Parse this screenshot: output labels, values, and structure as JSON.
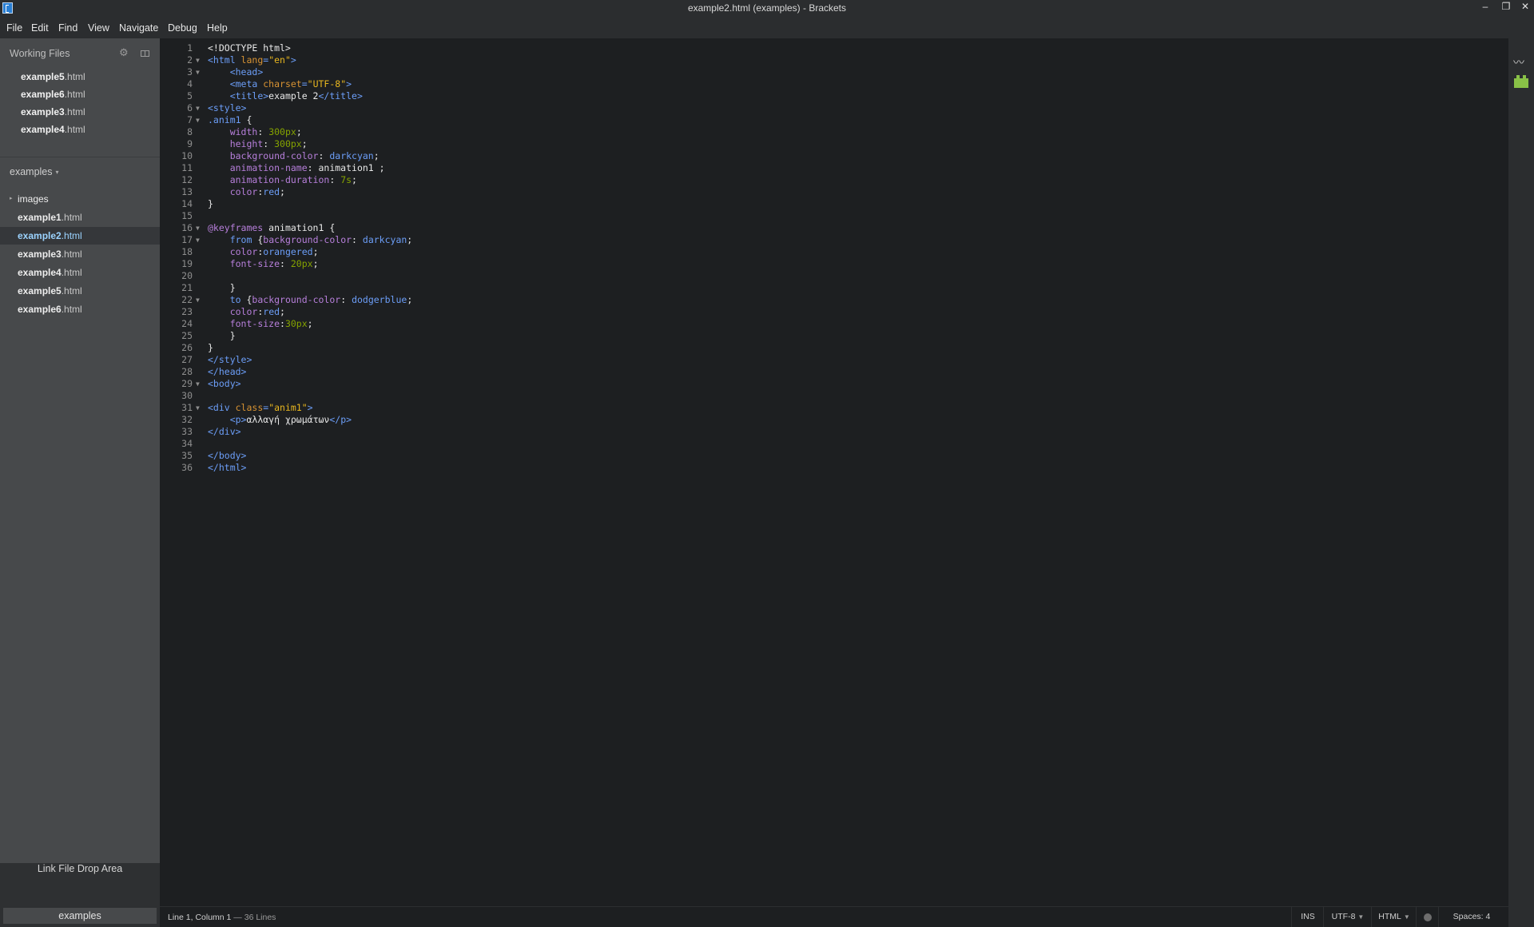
{
  "window": {
    "title": "example2.html (examples) - Brackets",
    "minimize": "–",
    "maximize": "❐",
    "close": "✕"
  },
  "menu": [
    "File",
    "Edit",
    "Find",
    "View",
    "Navigate",
    "Debug",
    "Help"
  ],
  "sidebar": {
    "working_files_title": "Working Files",
    "working_files": [
      {
        "base": "example5",
        "ext": ".html"
      },
      {
        "base": "example6",
        "ext": ".html"
      },
      {
        "base": "example3",
        "ext": ".html"
      },
      {
        "base": "example4",
        "ext": ".html"
      }
    ],
    "project_name": "examples",
    "project_caret": "▾",
    "tree": [
      {
        "type": "folder",
        "base": "images",
        "ext": ""
      },
      {
        "type": "file",
        "base": "example1",
        "ext": ".html"
      },
      {
        "type": "file",
        "base": "example2",
        "ext": ".html",
        "selected": true
      },
      {
        "type": "file",
        "base": "example3",
        "ext": ".html"
      },
      {
        "type": "file",
        "base": "example4",
        "ext": ".html"
      },
      {
        "type": "file",
        "base": "example5",
        "ext": ".html"
      },
      {
        "type": "file",
        "base": "example6",
        "ext": ".html"
      }
    ],
    "drop_area_label": "Link File Drop Area",
    "bottom_project": "examples"
  },
  "editor": {
    "lines": [
      {
        "n": 1,
        "fold": false,
        "t": [
          [
            "<!DOCTYPE html>",
            "plain"
          ]
        ]
      },
      {
        "n": 2,
        "fold": true,
        "t": [
          [
            "<html ",
            "tag"
          ],
          [
            "lang",
            "attr"
          ],
          [
            "=",
            "tag"
          ],
          [
            "\"en\"",
            "str"
          ],
          [
            ">",
            "tag"
          ]
        ]
      },
      {
        "n": 3,
        "fold": true,
        "t": [
          [
            "    ",
            "plain"
          ],
          [
            "<head>",
            "tag"
          ]
        ]
      },
      {
        "n": 4,
        "fold": false,
        "t": [
          [
            "    ",
            "plain"
          ],
          [
            "<meta ",
            "tag"
          ],
          [
            "charset",
            "attr"
          ],
          [
            "=",
            "tag"
          ],
          [
            "\"UTF-8\"",
            "str"
          ],
          [
            ">",
            "tag"
          ]
        ]
      },
      {
        "n": 5,
        "fold": false,
        "t": [
          [
            "    ",
            "plain"
          ],
          [
            "<title>",
            "tag"
          ],
          [
            "example 2",
            "plain"
          ],
          [
            "</title>",
            "tag"
          ]
        ]
      },
      {
        "n": 6,
        "fold": true,
        "t": [
          [
            "<style>",
            "tag"
          ]
        ]
      },
      {
        "n": 7,
        "fold": true,
        "t": [
          [
            ".anim1",
            "tag"
          ],
          [
            " {",
            "plain"
          ]
        ]
      },
      {
        "n": 8,
        "fold": false,
        "t": [
          [
            "    ",
            "plain"
          ],
          [
            "width",
            "prop"
          ],
          [
            ": ",
            "plain"
          ],
          [
            "300px",
            "num"
          ],
          [
            ";",
            "plain"
          ]
        ]
      },
      {
        "n": 9,
        "fold": false,
        "t": [
          [
            "    ",
            "plain"
          ],
          [
            "height",
            "prop"
          ],
          [
            ": ",
            "plain"
          ],
          [
            "300px",
            "num"
          ],
          [
            ";",
            "plain"
          ]
        ]
      },
      {
        "n": 10,
        "fold": false,
        "t": [
          [
            "    ",
            "plain"
          ],
          [
            "background-color",
            "prop"
          ],
          [
            ": ",
            "plain"
          ],
          [
            "darkcyan",
            "val"
          ],
          [
            ";",
            "plain"
          ]
        ]
      },
      {
        "n": 11,
        "fold": false,
        "t": [
          [
            "    ",
            "plain"
          ],
          [
            "animation-name",
            "prop"
          ],
          [
            ": animation1 ;",
            "plain"
          ]
        ]
      },
      {
        "n": 12,
        "fold": false,
        "t": [
          [
            "    ",
            "plain"
          ],
          [
            "animation-duration",
            "prop"
          ],
          [
            ": ",
            "plain"
          ],
          [
            "7s",
            "num"
          ],
          [
            ";",
            "plain"
          ]
        ]
      },
      {
        "n": 13,
        "fold": false,
        "t": [
          [
            "    ",
            "plain"
          ],
          [
            "color",
            "prop"
          ],
          [
            ":",
            "plain"
          ],
          [
            "red",
            "val"
          ],
          [
            ";",
            "plain"
          ]
        ]
      },
      {
        "n": 14,
        "fold": false,
        "t": [
          [
            "}",
            "plain"
          ]
        ]
      },
      {
        "n": 15,
        "fold": false,
        "t": []
      },
      {
        "n": 16,
        "fold": true,
        "t": [
          [
            "@keyframes",
            "kw"
          ],
          [
            " animation1 {",
            "plain"
          ]
        ]
      },
      {
        "n": 17,
        "fold": true,
        "t": [
          [
            "    ",
            "plain"
          ],
          [
            "from",
            "tag"
          ],
          [
            " {",
            "plain"
          ],
          [
            "background-color",
            "prop"
          ],
          [
            ": ",
            "plain"
          ],
          [
            "darkcyan",
            "val"
          ],
          [
            ";",
            "plain"
          ]
        ]
      },
      {
        "n": 18,
        "fold": false,
        "t": [
          [
            "    ",
            "plain"
          ],
          [
            "color",
            "prop"
          ],
          [
            ":",
            "plain"
          ],
          [
            "orangered",
            "val"
          ],
          [
            ";",
            "plain"
          ]
        ]
      },
      {
        "n": 19,
        "fold": false,
        "t": [
          [
            "    ",
            "plain"
          ],
          [
            "font-size",
            "prop"
          ],
          [
            ": ",
            "plain"
          ],
          [
            "20px",
            "num"
          ],
          [
            ";",
            "plain"
          ]
        ]
      },
      {
        "n": 20,
        "fold": false,
        "t": []
      },
      {
        "n": 21,
        "fold": false,
        "t": [
          [
            "    }",
            "plain"
          ]
        ]
      },
      {
        "n": 22,
        "fold": true,
        "t": [
          [
            "    ",
            "plain"
          ],
          [
            "to",
            "tag"
          ],
          [
            " {",
            "plain"
          ],
          [
            "background-color",
            "prop"
          ],
          [
            ": ",
            "plain"
          ],
          [
            "dodgerblue",
            "val"
          ],
          [
            ";",
            "plain"
          ]
        ]
      },
      {
        "n": 23,
        "fold": false,
        "t": [
          [
            "    ",
            "plain"
          ],
          [
            "color",
            "prop"
          ],
          [
            ":",
            "plain"
          ],
          [
            "red",
            "val"
          ],
          [
            ";",
            "plain"
          ]
        ]
      },
      {
        "n": 24,
        "fold": false,
        "t": [
          [
            "    ",
            "plain"
          ],
          [
            "font-size",
            "prop"
          ],
          [
            ":",
            "plain"
          ],
          [
            "30px",
            "num"
          ],
          [
            ";",
            "plain"
          ]
        ]
      },
      {
        "n": 25,
        "fold": false,
        "t": [
          [
            "    }",
            "plain"
          ]
        ]
      },
      {
        "n": 26,
        "fold": false,
        "t": [
          [
            "}",
            "plain"
          ]
        ]
      },
      {
        "n": 27,
        "fold": false,
        "t": [
          [
            "</style>",
            "tag"
          ]
        ]
      },
      {
        "n": 28,
        "fold": false,
        "t": [
          [
            "</head>",
            "tag"
          ]
        ]
      },
      {
        "n": 29,
        "fold": true,
        "t": [
          [
            "<body>",
            "tag"
          ]
        ]
      },
      {
        "n": 30,
        "fold": false,
        "t": []
      },
      {
        "n": 31,
        "fold": true,
        "t": [
          [
            "<div ",
            "tag"
          ],
          [
            "class",
            "attr"
          ],
          [
            "=",
            "tag"
          ],
          [
            "\"anim1\"",
            "str"
          ],
          [
            ">",
            "tag"
          ]
        ]
      },
      {
        "n": 32,
        "fold": false,
        "t": [
          [
            "    ",
            "plain"
          ],
          [
            "<p>",
            "tag"
          ],
          [
            "αλλαγή χρωμάτων",
            "plain"
          ],
          [
            "</p>",
            "tag"
          ]
        ]
      },
      {
        "n": 33,
        "fold": false,
        "t": [
          [
            "</div>",
            "tag"
          ]
        ]
      },
      {
        "n": 34,
        "fold": false,
        "t": []
      },
      {
        "n": 35,
        "fold": false,
        "t": [
          [
            "</body>",
            "tag"
          ]
        ]
      },
      {
        "n": 36,
        "fold": false,
        "t": [
          [
            "</html>",
            "tag"
          ]
        ]
      }
    ],
    "fold_glyph": "▼"
  },
  "statusbar": {
    "cursor": "Line 1, Column 1",
    "lines": " — 36 Lines",
    "ins": "INS",
    "encoding": "UTF-8",
    "language": "HTML",
    "spaces": "Spaces: 4",
    "dropdown_glyph": "▼"
  },
  "icons": {
    "gear": "⚙",
    "live_preview": "〰",
    "folder_arrow": "▸"
  },
  "colors": {
    "sidebar_bg": "#47494b",
    "editor_bg": "#1d1f21",
    "selected_file": "#9bd3ff",
    "extension_icon": "#89c147"
  }
}
